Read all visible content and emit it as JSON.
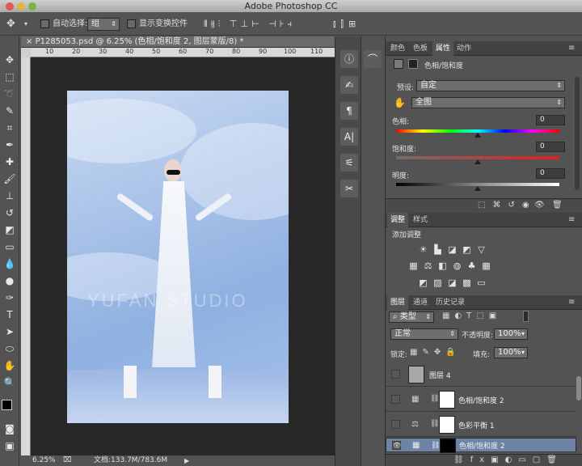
{
  "window": {
    "title": "Adobe Photoshop CC"
  },
  "options_bar": {
    "auto_select_label": "自动选择:",
    "auto_select_value": "组",
    "show_transform_label": "显示变换控件"
  },
  "document": {
    "tab_label": "P1285053.psd @ 6.25% (色相/饱和度 2, 图层蒙版/8) *",
    "ruler_marks": [
      "10",
      "20",
      "30",
      "40",
      "50",
      "60",
      "70",
      "80",
      "90",
      "100",
      "110"
    ],
    "watermark": "YUFAN STUDIO",
    "zoom": "6.25%",
    "doc_size": "文档:133.7M/783.6M"
  },
  "properties_panel": {
    "tabs": [
      "颜色",
      "色板",
      "属性",
      "动作"
    ],
    "active_tab": "属性",
    "header": "色相/饱和度",
    "preset_label": "预设:",
    "preset_value": "自定",
    "channel_value": "全图",
    "hue_label": "色相:",
    "hue_value": "0",
    "saturation_label": "饱和度:",
    "saturation_value": "0",
    "lightness_label": "明度:",
    "lightness_value": "0"
  },
  "adjustments_panel": {
    "tabs": [
      "调整",
      "样式"
    ],
    "title": "添加调整"
  },
  "layers_panel": {
    "tabs": [
      "图层",
      "通道",
      "历史记录"
    ],
    "filter_label": "类型",
    "blend_mode": "正常",
    "opacity_label": "不透明度:",
    "opacity_value": "100%",
    "lock_label": "锁定:",
    "fill_label": "填充:",
    "fill_value": "100%",
    "layers": [
      {
        "name": "图层 4"
      },
      {
        "name": "色相/饱和度 2"
      },
      {
        "name": "色彩平衡 1"
      },
      {
        "name": "色相/饱和度 2"
      }
    ]
  },
  "colors": {
    "selection": "#6d84a7",
    "panel": "#535353"
  }
}
